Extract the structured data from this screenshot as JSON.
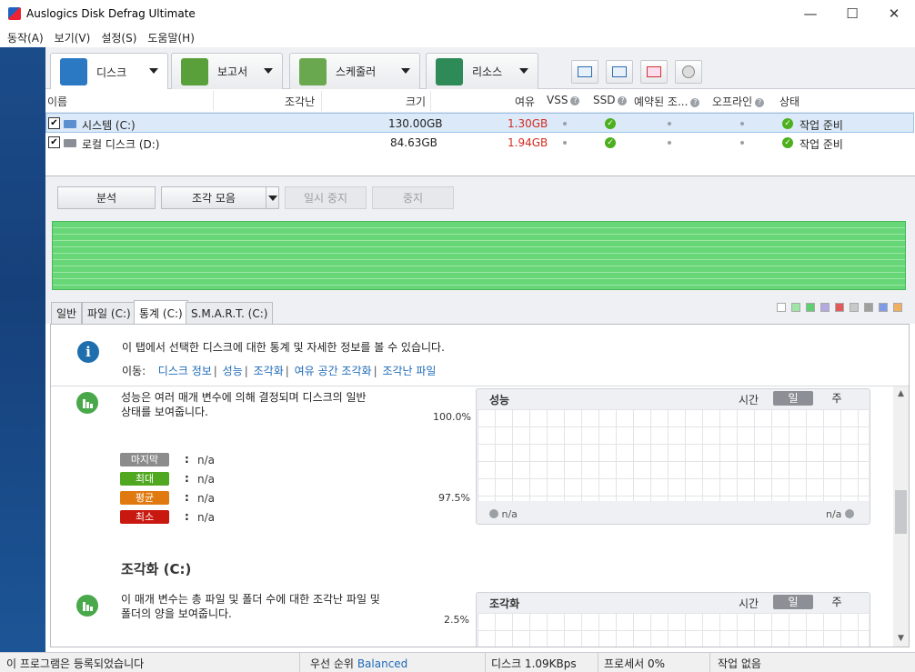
{
  "window": {
    "title": "Auslogics Disk Defrag Ultimate",
    "minimize": "—",
    "maximize": "☐",
    "close": "✕"
  },
  "menu": [
    "동작(A)",
    "보기(V)",
    "설정(S)",
    "도움말(H)"
  ],
  "toolbar": {
    "tabs": [
      {
        "label": "디스크",
        "icon": "disk-icon",
        "color": "#2a79c2"
      },
      {
        "label": "보고서",
        "icon": "report-icon",
        "color": "#5aa03a"
      },
      {
        "label": "스케줄러",
        "icon": "calendar-icon",
        "color": "#6aa84f"
      },
      {
        "label": "리소스",
        "icon": "resources-icon",
        "color": "#2e8b57"
      }
    ],
    "tool_icons": [
      "system-info-icon",
      "performance-icon",
      "tools-icon",
      "settings-icon"
    ]
  },
  "drivelist": {
    "columns": {
      "name": "이름",
      "fragmented": "조각난",
      "size": "크기",
      "free": "여유",
      "vss": "VSS",
      "ssd": "SSD",
      "reserved": "예약된 조...",
      "offline": "오프라인",
      "status": "상태"
    },
    "drives": [
      {
        "checked": "✔",
        "name": "시스템 (C:)",
        "size": "130.00GB",
        "free": "1.30GB",
        "status": "작업 준비"
      },
      {
        "checked": "✔",
        "name": "로컬 디스크 (D:)",
        "size": "84.63GB",
        "free": "1.94GB",
        "status": "작업 준비"
      }
    ]
  },
  "actions": {
    "analyze": "분석",
    "defrag": "조각 모음",
    "pause": "일시 중지",
    "stop": "중지"
  },
  "lower_tabs": [
    "일반",
    "파일 (C:)",
    "통계 (C:)",
    "S.M.A.R.T. (C:)"
  ],
  "legend_colors": [
    "#ffffff",
    "#9ee6a6",
    "#5fd06f",
    "#b6a8e0",
    "#e35a5a",
    "#c8c8c8",
    "#a0a0a0",
    "#7f9be6",
    "#f0b060"
  ],
  "stats": {
    "info": "이 탭에서 선택한 디스크에 대한 통계 및 자세한 정보를 볼 수 있습니다.",
    "nav_label": "이동:",
    "nav_links": [
      "디스크 정보",
      "성능",
      "조각화",
      "여유 공간 조각화",
      "조각난 파일"
    ],
    "performance": {
      "desc_line1": "성능은 여러 매개 변수에 의해 결정되며 디스크의 일반",
      "desc_line2": "상태를 보여줍니다.",
      "pct_top": "100.0%",
      "pct_bottom": "97.5%",
      "metrics": [
        {
          "label": "마지막",
          "value": "n/a",
          "color": "#8c8c8c"
        },
        {
          "label": "최대",
          "value": "n/a",
          "color": "#4fa81f"
        },
        {
          "label": "평균",
          "value": "n/a",
          "color": "#e07a10"
        },
        {
          "label": "최소",
          "value": "n/a",
          "color": "#c8180f"
        }
      ],
      "chart": {
        "title": "성능",
        "time_label": "시간",
        "day": "일",
        "week": "주",
        "left_foot": "n/a",
        "right_foot": "n/a"
      }
    },
    "fragmentation": {
      "title": "조각화 (C:)",
      "desc_line1": "이 매개 변수는 총 파일 및 폴더 수에 대한 조각난 파일 및",
      "desc_line2": "폴더의 양을 보여줍니다.",
      "pct_top": "2.5%",
      "chart": {
        "title": "조각화",
        "time_label": "시간",
        "day": "일",
        "week": "주"
      }
    }
  },
  "statusbar": {
    "registered": "이 프로그램은 등록되었습니다",
    "priority_label": "우선 순위",
    "priority_value": "Balanced",
    "disk": "디스크 1.09KBps",
    "processor": "프로세서 0%",
    "jobs": "작업 없음"
  }
}
